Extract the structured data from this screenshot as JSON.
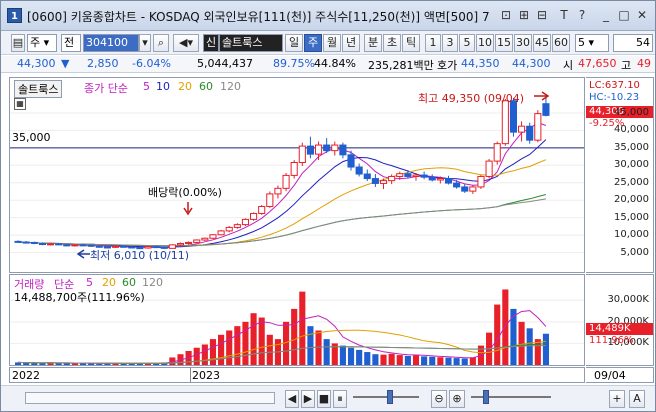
{
  "window": {
    "number": "1",
    "title": "[0600] 키움종합차트 - KOSDAQ 외국인보유[111(천)] 주식수[11,250(천)] 액면[500] 7",
    "buttons": [
      "⊡",
      "⊞",
      "⊟",
      "T",
      "?",
      "_",
      "□",
      "✕"
    ]
  },
  "toolbar": {
    "market": "주",
    "order": "전",
    "code": "304100",
    "search_icon": "search-icon",
    "sound_icon": "speaker-icon",
    "sin_badge": "신",
    "stock_name": "솔트룩스",
    "period_buttons": [
      "일",
      "주",
      "월",
      "년",
      "분",
      "초",
      "틱"
    ],
    "selected_period": "주",
    "interval_buttons": [
      "1",
      "3",
      "5",
      "10",
      "15",
      "30",
      "45",
      "60"
    ],
    "interval_select": "5",
    "count_value": "54"
  },
  "quote": {
    "price": "44,300",
    "change": "2,850",
    "change_pct": "-6.04%",
    "volume": "5,044,437",
    "ratio1": "89.75%",
    "ratio2": "44.84%",
    "amount": "235,281백만",
    "ho_label": "호가",
    "bid": "44,350",
    "ask": "44,300",
    "open_label": "시",
    "open": "47,650",
    "high_label": "고",
    "high": "49"
  },
  "price_panel": {
    "stock_tag": "솔트룩스",
    "legend_prefix": "종가 단순",
    "ma_periods": [
      "5",
      "10",
      "20",
      "60",
      "120"
    ],
    "ma_colors": [
      "#c020c0",
      "#1f1fbf",
      "#e0a000",
      "#2a8a2a",
      "#888888"
    ],
    "hline_label": "35,000",
    "dividend_label": "배당락(0.00%)",
    "high_annotation": "최고 49,350 (09/04)",
    "low_annotation": "최저 6,010 (10/11)"
  },
  "price_scale": {
    "lc": "LC:637.10",
    "hc": "HC:-10.23",
    "current": "44,300",
    "pct": "-9.25%",
    "ticks": [
      "45,000",
      "40,000",
      "35,000",
      "30,000",
      "25,000",
      "20,000",
      "15,000",
      "10,000",
      "5,000"
    ]
  },
  "volume_panel": {
    "legend_prefix": "거래량",
    "legend_type": "단순",
    "ma_periods": [
      "5",
      "20",
      "60",
      "120"
    ],
    "value_label": "14,488,700주(111.96%)"
  },
  "volume_scale": {
    "ticks": [
      "30,000K",
      "20,000K",
      "10,000K"
    ],
    "current": "14,489K",
    "pct": "111.96%"
  },
  "date_axis": {
    "labels": [
      "2022",
      "2023"
    ],
    "right_label": "09/04"
  },
  "bottom_controls": [
    "◀",
    "▶",
    "■",
    "⏸",
    "⊖",
    "⊕",
    "+",
    "A"
  ],
  "colors": {
    "up": "#e8202a",
    "down": "#1f5fd0",
    "accent": "#3c6cc4"
  },
  "chart_data": {
    "type": "candlestick",
    "x_start": "2022-01",
    "x_unit": "week",
    "y_range": [
      0,
      51000
    ],
    "candles": [
      [
        8200,
        8500,
        7800,
        8000
      ],
      [
        8000,
        8300,
        7600,
        7900
      ],
      [
        7900,
        8100,
        7400,
        7600
      ],
      [
        7600,
        7900,
        7100,
        7300
      ],
      [
        7300,
        7700,
        7000,
        7500
      ],
      [
        7500,
        7800,
        7100,
        7200
      ],
      [
        7200,
        7400,
        6800,
        7000
      ],
      [
        7000,
        7400,
        6700,
        7200
      ],
      [
        7200,
        7600,
        6900,
        7100
      ],
      [
        7100,
        7300,
        6600,
        6800
      ],
      [
        6800,
        7100,
        6400,
        6600
      ],
      [
        6600,
        6900,
        6300,
        6500
      ],
      [
        6500,
        6900,
        6300,
        6800
      ],
      [
        6800,
        7100,
        6400,
        6600
      ],
      [
        6600,
        6900,
        6300,
        6400
      ],
      [
        6400,
        6700,
        6100,
        6300
      ],
      [
        6300,
        6900,
        6100,
        6700
      ],
      [
        6700,
        7000,
        6300,
        6500
      ],
      [
        6500,
        6800,
        6010,
        6200
      ],
      [
        6200,
        7400,
        6100,
        7200
      ],
      [
        7200,
        7900,
        6900,
        7600
      ],
      [
        7600,
        8200,
        7300,
        7900
      ],
      [
        7900,
        8800,
        7700,
        8600
      ],
      [
        8600,
        9300,
        8300,
        9100
      ],
      [
        9100,
        10300,
        8900,
        10100
      ],
      [
        10100,
        11500,
        9900,
        11200
      ],
      [
        11200,
        12600,
        10800,
        12200
      ],
      [
        12200,
        13400,
        11800,
        13000
      ],
      [
        13000,
        14800,
        12600,
        14500
      ],
      [
        14500,
        16500,
        14100,
        16200
      ],
      [
        16200,
        18600,
        15800,
        18200
      ],
      [
        18200,
        22500,
        17800,
        21800
      ],
      [
        21800,
        24200,
        20500,
        23400
      ],
      [
        23400,
        27800,
        22600,
        27100
      ],
      [
        27100,
        31500,
        26200,
        30800
      ],
      [
        30800,
        36500,
        29800,
        35500
      ],
      [
        35500,
        38200,
        32000,
        33200
      ],
      [
        33200,
        36800,
        31500,
        35800
      ],
      [
        35800,
        37800,
        33500,
        34200
      ],
      [
        34200,
        36800,
        32800,
        35800
      ],
      [
        35800,
        36500,
        32000,
        33000
      ],
      [
        33000,
        34200,
        28500,
        29500
      ],
      [
        29500,
        30500,
        26800,
        27500
      ],
      [
        27500,
        28800,
        25500,
        26200
      ],
      [
        26200,
        27500,
        23800,
        24800
      ],
      [
        24800,
        26200,
        23200,
        25600
      ],
      [
        25600,
        27400,
        24600,
        26800
      ],
      [
        26800,
        28200,
        25800,
        27600
      ],
      [
        27600,
        28600,
        26200,
        26800
      ],
      [
        26800,
        27800,
        25600,
        27200
      ],
      [
        27200,
        28200,
        26000,
        26600
      ],
      [
        26600,
        27400,
        25400,
        25800
      ],
      [
        25800,
        26800,
        24800,
        26200
      ],
      [
        26200,
        27000,
        24500,
        24900
      ],
      [
        24900,
        25800,
        23300,
        23800
      ],
      [
        23800,
        24600,
        22100,
        22600
      ],
      [
        22600,
        24400,
        21800,
        23800
      ],
      [
        23800,
        27200,
        23200,
        26800
      ],
      [
        26800,
        31800,
        26200,
        31200
      ],
      [
        31200,
        36800,
        30200,
        36200
      ],
      [
        36200,
        49000,
        35600,
        48500
      ],
      [
        48500,
        49350,
        38200,
        39500
      ],
      [
        39500,
        42600,
        36800,
        41200
      ],
      [
        41200,
        42200,
        36200,
        37200
      ],
      [
        37200,
        45800,
        36600,
        44800
      ],
      [
        47650,
        49350,
        44000,
        44300
      ]
    ],
    "volumes_k": [
      1200,
      1000,
      900,
      800,
      1100,
      900,
      800,
      900,
      700,
      800,
      600,
      700,
      800,
      700,
      600,
      700,
      900,
      800,
      1200,
      3500,
      5000,
      6500,
      8000,
      9500,
      12000,
      14000,
      16000,
      18000,
      20000,
      24000,
      22000,
      14000,
      12000,
      20000,
      26000,
      34000,
      18000,
      16000,
      12000,
      10000,
      9000,
      8000,
      7000,
      6000,
      5000,
      4800,
      5200,
      4600,
      4200,
      4400,
      4000,
      3800,
      3600,
      3400,
      3200,
      3000,
      3500,
      9000,
      15000,
      28000,
      35000,
      26000,
      20000,
      17000,
      12000,
      14489
    ]
  }
}
